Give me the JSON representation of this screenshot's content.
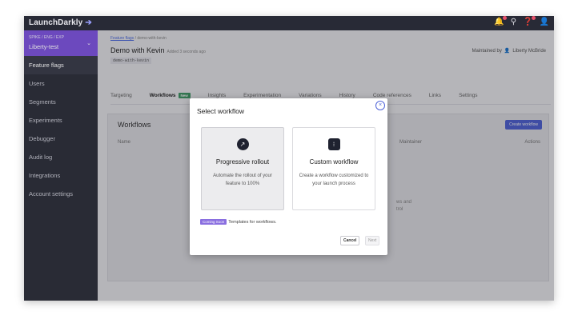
{
  "topbar": {
    "logo_text": "LaunchDarkly",
    "logo_arrow": "➔",
    "icons": [
      "bell-icon",
      "search-icon",
      "help-icon",
      "user-icon"
    ]
  },
  "sidebar": {
    "project_sup": "SPIKE / ENG / EXP",
    "project_name": "Liberty-test",
    "items": [
      {
        "label": "Feature flags"
      },
      {
        "label": "Users"
      },
      {
        "label": "Segments"
      },
      {
        "label": "Experiments"
      },
      {
        "label": "Debugger"
      },
      {
        "label": "Audit log"
      },
      {
        "label": "Integrations"
      },
      {
        "label": "Account settings"
      }
    ]
  },
  "main": {
    "breadcrumb_link": "Feature flags",
    "breadcrumb_rest": " / demo-with-kevin",
    "title": "Demo with Kevin",
    "added": "Added 3 seconds ago",
    "key": "demo-with-kevin",
    "maintained_label": "Maintained by",
    "maintainer": "Liberty McBride",
    "tabs": [
      {
        "label": "Targeting"
      },
      {
        "label": "Workflows",
        "badge": "New"
      },
      {
        "label": "Insights"
      },
      {
        "label": "Experimentation"
      },
      {
        "label": "Variations"
      },
      {
        "label": "History"
      },
      {
        "label": "Code references"
      },
      {
        "label": "Links"
      },
      {
        "label": "Settings"
      }
    ],
    "panel": {
      "title": "Workflows",
      "create_button": "Create workflow",
      "col_name": "Name",
      "col_maintainer": "Maintainer",
      "col_actions": "Actions",
      "empty_line1": "ws and",
      "empty_line2": "trol"
    }
  },
  "modal": {
    "title": "Select workflow",
    "close": "×",
    "options": [
      {
        "title": "Progressive rollout",
        "desc": "Automate the rollout of your feature to 100%",
        "icon": "↗"
      },
      {
        "title": "Custom workflow",
        "desc": "Create a workflow customized to your launch process",
        "icon": "⁝"
      }
    ],
    "coming_badge": "Coming Soon",
    "coming_text": "Templates for workflows.",
    "cancel": "Cancel",
    "next": "Next"
  }
}
